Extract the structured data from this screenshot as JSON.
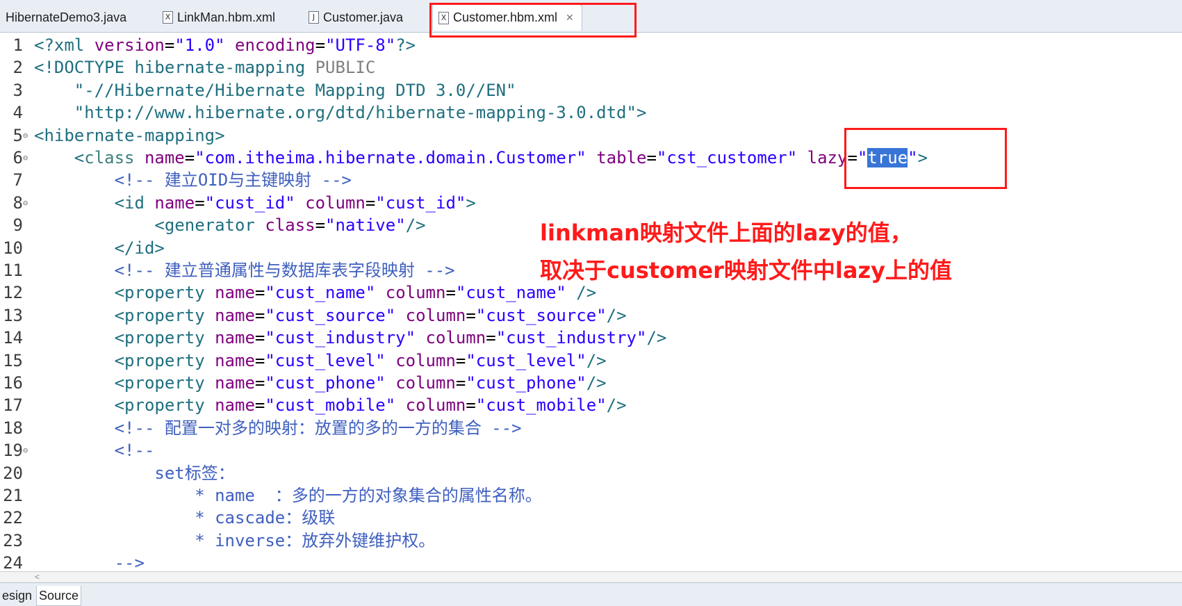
{
  "tabs": [
    {
      "label": "HibernateDemo3.java",
      "icon": "java-file-icon"
    },
    {
      "label": "LinkMan.hbm.xml",
      "icon": "xml-file-icon"
    },
    {
      "label": "Customer.java",
      "icon": "java-file-icon"
    },
    {
      "label": "Customer.hbm.xml",
      "icon": "xml-file-icon",
      "active": true
    }
  ],
  "code_lines": [
    {
      "n": "1",
      "fold": false,
      "tokens": [
        [
          "<?xml ",
          "#1f6f7f"
        ],
        [
          "version",
          "#7f007f"
        ],
        [
          "=",
          "#000"
        ],
        [
          "\"1.0\"",
          "#2a00ff"
        ],
        [
          " ",
          "#000"
        ],
        [
          "encoding",
          "#7f007f"
        ],
        [
          "=",
          "#000"
        ],
        [
          "\"UTF-8\"",
          "#2a00ff"
        ],
        [
          "?>",
          "#1f6f7f"
        ]
      ]
    },
    {
      "n": "2",
      "fold": false,
      "tokens": [
        [
          "<!DOCTYPE ",
          "#1f6f7f"
        ],
        [
          "hibernate-mapping ",
          "#1f6f7f"
        ],
        [
          "PUBLIC",
          "#808080"
        ]
      ]
    },
    {
      "n": "3",
      "fold": false,
      "tokens": [
        [
          "    \"-//Hibernate/Hibernate Mapping DTD 3.0//EN\"",
          "#1f6f7f"
        ]
      ]
    },
    {
      "n": "4",
      "fold": false,
      "tokens": [
        [
          "    \"http://www.hibernate.org/dtd/hibernate-mapping-3.0.dtd\">",
          "#1f6f7f"
        ]
      ]
    },
    {
      "n": "5",
      "fold": true,
      "tokens": [
        [
          "<hibernate-mapping>",
          "#1f6f7f"
        ]
      ]
    },
    {
      "n": "6",
      "fold": true,
      "tokens": [
        [
          "    <",
          "#1f6f7f"
        ],
        [
          "class",
          "#3f7f7f"
        ],
        [
          " ",
          "#000"
        ],
        [
          "name",
          "#7f007f"
        ],
        [
          "=",
          "#000"
        ],
        [
          "\"com.itheima.hibernate.domain.Customer\"",
          "#2a00ff"
        ],
        [
          " ",
          "#000"
        ],
        [
          "table",
          "#7f007f"
        ],
        [
          "=",
          "#000"
        ],
        [
          "\"cst_customer\"",
          "#2a00ff"
        ],
        [
          " ",
          "#000"
        ],
        [
          "lazy",
          "#7f007f"
        ],
        [
          "=",
          "#000"
        ],
        [
          "\"",
          "#2a00ff"
        ],
        [
          "true",
          "SEL"
        ],
        [
          "\"",
          "#2a00ff"
        ],
        [
          ">",
          "#1f6f7f"
        ]
      ]
    },
    {
      "n": "7",
      "fold": false,
      "tokens": [
        [
          "        <!-- 建立OID与主键映射 -->",
          "#3f5fbf"
        ]
      ]
    },
    {
      "n": "8",
      "fold": true,
      "tokens": [
        [
          "        <id ",
          "#1f6f7f"
        ],
        [
          "name",
          "#7f007f"
        ],
        [
          "=",
          "#000"
        ],
        [
          "\"cust_id\"",
          "#2a00ff"
        ],
        [
          " ",
          "#000"
        ],
        [
          "column",
          "#7f007f"
        ],
        [
          "=",
          "#000"
        ],
        [
          "\"cust_id\"",
          "#2a00ff"
        ],
        [
          ">",
          "#1f6f7f"
        ]
      ]
    },
    {
      "n": "9",
      "fold": false,
      "tokens": [
        [
          "            <generator ",
          "#1f6f7f"
        ],
        [
          "class",
          "#7f007f"
        ],
        [
          "=",
          "#000"
        ],
        [
          "\"native\"",
          "#2a00ff"
        ],
        [
          "/>",
          "#1f6f7f"
        ]
      ]
    },
    {
      "n": "10",
      "fold": false,
      "tokens": [
        [
          "        </id>",
          "#1f6f7f"
        ]
      ]
    },
    {
      "n": "11",
      "fold": false,
      "tokens": [
        [
          "        <!-- 建立普通属性与数据库表字段映射 -->",
          "#3f5fbf"
        ]
      ]
    },
    {
      "n": "12",
      "fold": false,
      "tokens": [
        [
          "        <property ",
          "#1f6f7f"
        ],
        [
          "name",
          "#7f007f"
        ],
        [
          "=",
          "#000"
        ],
        [
          "\"cust_name\"",
          "#2a00ff"
        ],
        [
          " ",
          "#000"
        ],
        [
          "column",
          "#7f007f"
        ],
        [
          "=",
          "#000"
        ],
        [
          "\"cust_name\"",
          "#2a00ff"
        ],
        [
          " />",
          "#1f6f7f"
        ]
      ]
    },
    {
      "n": "13",
      "fold": false,
      "tokens": [
        [
          "        <property ",
          "#1f6f7f"
        ],
        [
          "name",
          "#7f007f"
        ],
        [
          "=",
          "#000"
        ],
        [
          "\"cust_source\"",
          "#2a00ff"
        ],
        [
          " ",
          "#000"
        ],
        [
          "column",
          "#7f007f"
        ],
        [
          "=",
          "#000"
        ],
        [
          "\"cust_source\"",
          "#2a00ff"
        ],
        [
          "/>",
          "#1f6f7f"
        ]
      ]
    },
    {
      "n": "14",
      "fold": false,
      "tokens": [
        [
          "        <property ",
          "#1f6f7f"
        ],
        [
          "name",
          "#7f007f"
        ],
        [
          "=",
          "#000"
        ],
        [
          "\"cust_industry\"",
          "#2a00ff"
        ],
        [
          " ",
          "#000"
        ],
        [
          "column",
          "#7f007f"
        ],
        [
          "=",
          "#000"
        ],
        [
          "\"cust_industry\"",
          "#2a00ff"
        ],
        [
          "/>",
          "#1f6f7f"
        ]
      ]
    },
    {
      "n": "15",
      "fold": false,
      "tokens": [
        [
          "        <property ",
          "#1f6f7f"
        ],
        [
          "name",
          "#7f007f"
        ],
        [
          "=",
          "#000"
        ],
        [
          "\"cust_level\"",
          "#2a00ff"
        ],
        [
          " ",
          "#000"
        ],
        [
          "column",
          "#7f007f"
        ],
        [
          "=",
          "#000"
        ],
        [
          "\"cust_level\"",
          "#2a00ff"
        ],
        [
          "/>",
          "#1f6f7f"
        ]
      ]
    },
    {
      "n": "16",
      "fold": false,
      "tokens": [
        [
          "        <property ",
          "#1f6f7f"
        ],
        [
          "name",
          "#7f007f"
        ],
        [
          "=",
          "#000"
        ],
        [
          "\"cust_phone\"",
          "#2a00ff"
        ],
        [
          " ",
          "#000"
        ],
        [
          "column",
          "#7f007f"
        ],
        [
          "=",
          "#000"
        ],
        [
          "\"cust_phone\"",
          "#2a00ff"
        ],
        [
          "/>",
          "#1f6f7f"
        ]
      ]
    },
    {
      "n": "17",
      "fold": false,
      "tokens": [
        [
          "        <property ",
          "#1f6f7f"
        ],
        [
          "name",
          "#7f007f"
        ],
        [
          "=",
          "#000"
        ],
        [
          "\"cust_mobile\"",
          "#2a00ff"
        ],
        [
          " ",
          "#000"
        ],
        [
          "column",
          "#7f007f"
        ],
        [
          "=",
          "#000"
        ],
        [
          "\"cust_mobile\"",
          "#2a00ff"
        ],
        [
          "/>",
          "#1f6f7f"
        ]
      ]
    },
    {
      "n": "18",
      "fold": false,
      "tokens": [
        [
          "        <!-- 配置一对多的映射：放置的多的一方的集合 -->",
          "#3f5fbf"
        ]
      ]
    },
    {
      "n": "19",
      "fold": true,
      "tokens": [
        [
          "        <!--",
          "#3f5fbf"
        ]
      ]
    },
    {
      "n": "20",
      "fold": false,
      "tokens": [
        [
          "            set标签：",
          "#3f5fbf"
        ]
      ]
    },
    {
      "n": "21",
      "fold": false,
      "tokens": [
        [
          "                * name  ：多的一方的对象集合的属性名称。",
          "#3f5fbf"
        ]
      ]
    },
    {
      "n": "22",
      "fold": false,
      "tokens": [
        [
          "                * cascade：级联",
          "#3f5fbf"
        ]
      ]
    },
    {
      "n": "23",
      "fold": false,
      "tokens": [
        [
          "                * inverse：放弃外键维护权。",
          "#3f5fbf"
        ]
      ]
    },
    {
      "n": "24",
      "fold": false,
      "tokens": [
        [
          "        -->",
          "#3f5fbf"
        ]
      ]
    }
  ],
  "annotation": {
    "line1": "linkman映射文件上面的lazy的值，",
    "line2": "取决于customer映射文件中lazy上的值"
  },
  "bottom_tabs": [
    "esign",
    "Source"
  ],
  "colors": {
    "highlight": "#ff1a1a",
    "selection": "#3875d7"
  }
}
